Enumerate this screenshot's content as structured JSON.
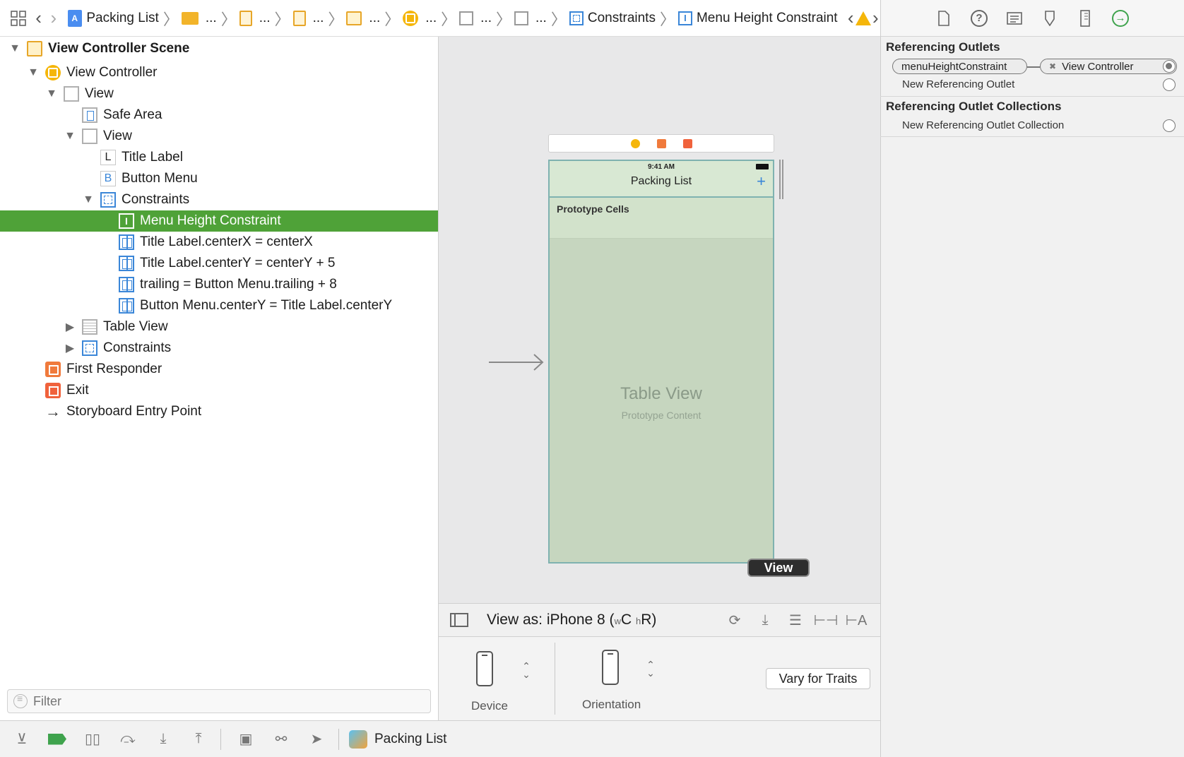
{
  "jumpbar": {
    "project": "Packing List",
    "ellipsis": "...",
    "constraints": "Constraints",
    "selected": "Menu Height Constraint"
  },
  "outline": {
    "rows": [
      {
        "label": "View Controller Scene"
      },
      {
        "label": "View Controller"
      },
      {
        "label": "View"
      },
      {
        "label": "Safe Area"
      },
      {
        "label": "View"
      },
      {
        "label": "Title Label",
        "letter": "L"
      },
      {
        "label": "Button Menu",
        "letter": "B"
      },
      {
        "label": "Constraints"
      },
      {
        "label": "Menu Height Constraint"
      },
      {
        "label": "Title Label.centerX = centerX"
      },
      {
        "label": "Title Label.centerY = centerY + 5"
      },
      {
        "label": "trailing = Button Menu.trailing + 8"
      },
      {
        "label": "Button Menu.centerY = Title Label.centerY"
      },
      {
        "label": "Table View"
      },
      {
        "label": "Constraints"
      },
      {
        "label": "First Responder"
      },
      {
        "label": "Exit"
      },
      {
        "label": "Storyboard Entry Point"
      }
    ],
    "filter_placeholder": "Filter"
  },
  "canvas": {
    "status_time": "9:41 AM",
    "nav_title": "Packing List",
    "nav_plus": "+",
    "prototype_cells": "Prototype Cells",
    "table_view_title": "Table View",
    "table_view_subtitle": "Prototype Content",
    "view_badge": "View"
  },
  "device_bar": {
    "view_as_prefix": "View as: iPhone 8 (",
    "w": "w",
    "c": "C",
    "h": "h",
    "r": "R)",
    "device_label": "Device",
    "orientation_label": "Orientation",
    "vary_button": "Vary for Traits"
  },
  "debugbar": {
    "app_name": "Packing List"
  },
  "inspector": {
    "referencing_outlets_title": "Referencing Outlets",
    "outlet_name": "menuHeightConstraint",
    "outlet_target": "View Controller",
    "new_referencing_outlet": "New Referencing Outlet",
    "outlet_collections_title": "Referencing Outlet Collections",
    "new_outlet_collection": "New Referencing Outlet Collection"
  },
  "colors": {
    "selection_green": "#4fa238",
    "constraint_blue": "#3a86d8",
    "vc_yellow": "#f5b60a",
    "canvas_bg": "#e8e8e9",
    "phone_fill": "#c6d6bf"
  }
}
